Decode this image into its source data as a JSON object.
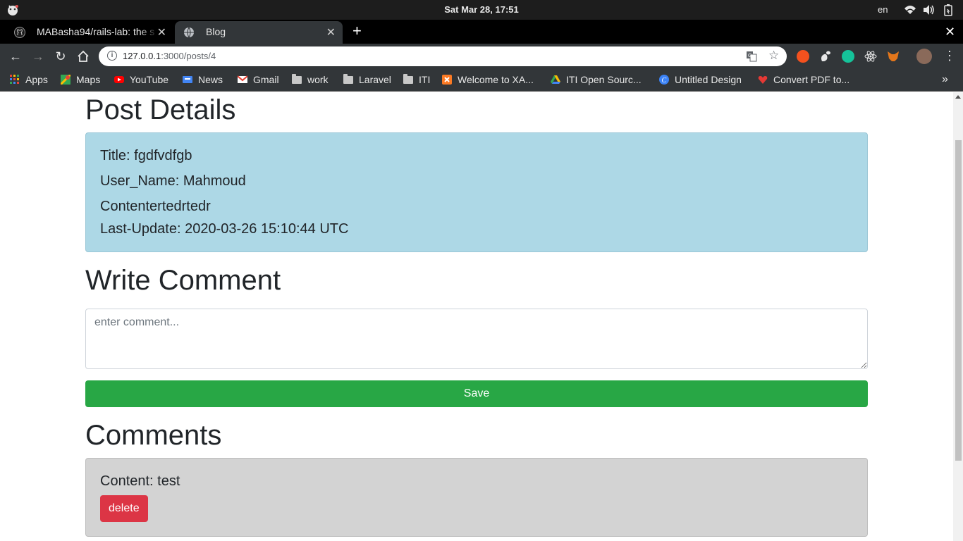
{
  "os": {
    "clock": "Sat Mar 28, 17:51",
    "lang": "en",
    "tray_icons": [
      "wifi-icon",
      "volume-icon",
      "battery-icon"
    ]
  },
  "browser": {
    "tabs": [
      {
        "title": "MABasha94/rails-lab: the s",
        "icon": "github-icon",
        "active": false
      },
      {
        "title": "Blog",
        "icon": "globe-icon",
        "active": true
      }
    ],
    "url_host": "127.0.0.1",
    "url_path": ":3000/posts/4",
    "bookmarks": [
      {
        "label": "Apps",
        "icon": "apps-grid-icon"
      },
      {
        "label": "Maps",
        "icon": "maps-icon"
      },
      {
        "label": "YouTube",
        "icon": "youtube-icon"
      },
      {
        "label": "News",
        "icon": "news-icon"
      },
      {
        "label": "Gmail",
        "icon": "gmail-icon"
      },
      {
        "label": "work",
        "icon": "folder-icon"
      },
      {
        "label": "Laravel",
        "icon": "folder-icon"
      },
      {
        "label": "ITI",
        "icon": "folder-icon"
      },
      {
        "label": "Welcome to XA...",
        "icon": "xampp-icon"
      },
      {
        "label": "ITI Open Sourc...",
        "icon": "drive-icon"
      },
      {
        "label": "Untitled Design",
        "icon": "canva-icon"
      },
      {
        "label": "Convert PDF to...",
        "icon": "pdf-heart-icon"
      }
    ]
  },
  "page": {
    "post_details_heading": "Post Details",
    "post": {
      "title_line": "Title: fgdfvdfgb",
      "user_line": "User_Name: Mahmoud",
      "content_line": "Contentertedrtedr",
      "updated_line": "Last-Update: 2020-03-26 15:10:44 UTC"
    },
    "write_comment_heading": "Write Comment",
    "comment_placeholder": "enter comment...",
    "comment_value": "",
    "save_label": "Save",
    "comments_heading": "Comments",
    "comments": [
      {
        "text": "Content: test",
        "delete_label": "delete"
      }
    ]
  },
  "colors": {
    "post_bg": "#add8e6",
    "comment_bg": "#d3d3d3",
    "save_btn": "#28a745",
    "delete_btn": "#dc3545"
  }
}
